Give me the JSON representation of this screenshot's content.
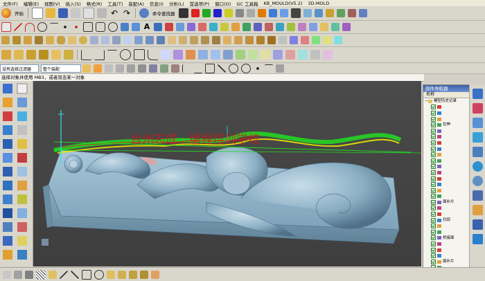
{
  "menu": [
    "文件(F)",
    "编辑(E)",
    "视图(V)",
    "插入(S)",
    "格式(R)",
    "工具(T)",
    "装配(A)",
    "信息(I)",
    "分析(L)",
    "首选项(P)",
    "窗口(O)",
    "GC 工具箱",
    "KB_MOULD(V5.2)",
    "3D-MOLD"
  ],
  "toolbar": {
    "start_label": "开始",
    "command_finder_label": "命令查找器"
  },
  "selection_bar": {
    "filter_value": "没有选择过滤器",
    "scope_value": "整个装配"
  },
  "cue_line": "选择对象并使用 MB3，或者双击某一对象",
  "watermark": "台州志成…编程培训学校",
  "navigator": {
    "title": "部件导航器",
    "column_name": "名称",
    "root": "模型历史记录",
    "items": [
      "",
      "",
      "",
      "拉伸",
      "",
      "",
      "",
      "",
      "",
      "",
      "",
      "",
      "",
      "",
      "",
      "",
      "面补片",
      "",
      "",
      "扫掠",
      "",
      "",
      "桥接面",
      "",
      "",
      "",
      "面补片",
      ""
    ]
  },
  "colors": {
    "viewport_bg": "#444444",
    "model": "#8fb3c9",
    "toolpath_green": "#22dd22",
    "toolpath_yellow": "#e8e800",
    "axis_cyan": "#35e0f0",
    "watermark_red": "#d81818",
    "title_blue": "#3b5fa8"
  },
  "icons": [
    "start-icon",
    "new-icon",
    "open-icon",
    "save-icon",
    "cut-icon",
    "copy-icon",
    "paste-icon",
    "undo-icon",
    "redo-icon",
    "command-finder-icon",
    "sketch-icon",
    "line-icon",
    "arc-icon",
    "rectangle-icon",
    "extrude-icon",
    "revolve-icon",
    "text-icon",
    "edit-object-icon",
    "blend-icon",
    "part-navigator-icon",
    "assembly-navigator-icon",
    "history-icon",
    "web-icon",
    "palette-icon",
    "role-icon"
  ]
}
